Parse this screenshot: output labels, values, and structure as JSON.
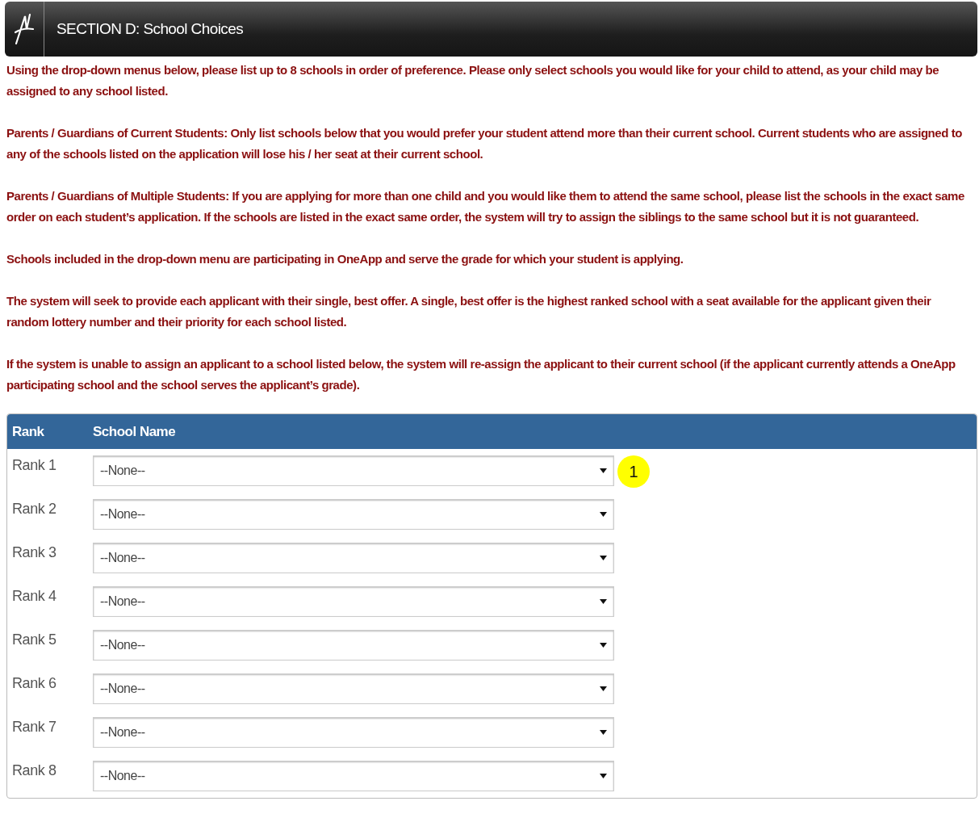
{
  "header": {
    "title": "SECTION D: School Choices"
  },
  "paragraphs": [
    "Using the drop-down menus below, please list up to 8 schools in order of preference. Please only select schools you would like for your child to attend, as your child may be assigned to any school listed.",
    "Parents / Guardians of Current Students: Only list schools below that you would prefer your student attend more than their current school. Current students who are assigned to any of the schools listed on the application will lose his / her seat at their current school.",
    "Parents / Guardians of Multiple Students: If you are applying for more than one child and you would like them to attend the same school, please list the schools in the exact same order on each student’s application. If the schools are listed in the exact same order, the system will try to assign the siblings to the same school but it is not guaranteed.",
    "Schools included in the drop-down menu are participating in OneApp and serve the grade for which your student is applying.",
    "The system will seek to provide each applicant with their single, best offer. A single, best offer is the highest ranked school with a seat available for the applicant given their random lottery number and their priority for each school listed.",
    "If the system is unable to assign an applicant to a school listed below, the system will re-assign the applicant to their current school (if the applicant currently attends a OneApp participating school and the school serves the applicant’s grade)."
  ],
  "table": {
    "columns": [
      "Rank",
      "School Name"
    ],
    "rows": [
      {
        "rank": "Rank 1",
        "value": "--None--"
      },
      {
        "rank": "Rank 2",
        "value": "--None--"
      },
      {
        "rank": "Rank 3",
        "value": "--None--"
      },
      {
        "rank": "Rank 4",
        "value": "--None--"
      },
      {
        "rank": "Rank 5",
        "value": "--None--"
      },
      {
        "rank": "Rank 6",
        "value": "--None--"
      },
      {
        "rank": "Rank 7",
        "value": "--None--"
      },
      {
        "rank": "Rank 8",
        "value": "--None--"
      }
    ]
  },
  "callout": {
    "label": "1"
  }
}
